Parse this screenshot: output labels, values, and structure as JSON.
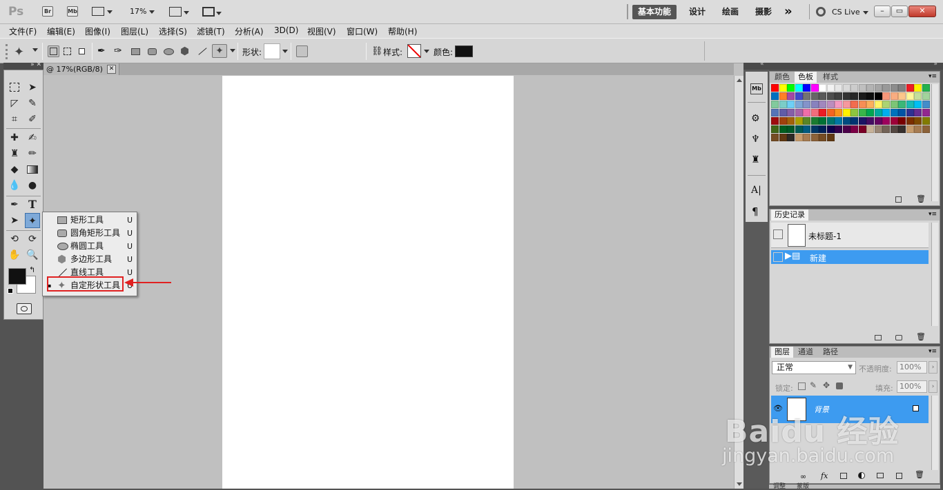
{
  "appbar": {
    "logo": "Ps",
    "app_icons": [
      "Br",
      "Mb"
    ],
    "zoom": "17%",
    "workspaces": [
      "基本功能",
      "设计",
      "绘画",
      "摄影"
    ],
    "more": "»",
    "cslive": "CS Live",
    "window_buttons": [
      "–",
      "▭",
      "✕"
    ]
  },
  "menu": [
    "文件(F)",
    "编辑(E)",
    "图像(I)",
    "图层(L)",
    "选择(S)",
    "滤镜(T)",
    "分析(A)",
    "3D(D)",
    "视图(V)",
    "窗口(W)",
    "帮助(H)"
  ],
  "options": {
    "shape_label": "形状:",
    "style_label": "样式:",
    "color_label": "颜色:",
    "color_value": "#111111"
  },
  "document": {
    "tab_title": "@ 17%(RGB/8)",
    "close": "✕"
  },
  "flyout": {
    "items": [
      {
        "label": "矩形工具",
        "key": "U"
      },
      {
        "label": "圆角矩形工具",
        "key": "U"
      },
      {
        "label": "椭圆工具",
        "key": "U"
      },
      {
        "label": "多边形工具",
        "key": "U"
      },
      {
        "label": "直线工具",
        "key": "U"
      },
      {
        "label": "自定形状工具",
        "key": "U"
      }
    ],
    "highlight_color": "#e02020"
  },
  "panels": {
    "swatches": {
      "tabs": [
        "颜色",
        "色板",
        "样式"
      ]
    },
    "history": {
      "tab": "历史记录",
      "snapshot": "未标题-1",
      "state": "新建"
    },
    "layers": {
      "tabs": [
        "图层",
        "通道",
        "路径"
      ],
      "blend_mode": "正常",
      "opacity_label": "不透明度:",
      "opacity": "100%",
      "lock_label": "锁定:",
      "fill_label": "填充:",
      "fill": "100%",
      "layer_name": "背景"
    },
    "bottom_tabs": [
      "调整",
      "蒙版"
    ]
  },
  "watermark": {
    "logo": "Baidu 经验",
    "url": "jingyan.baidu.com"
  },
  "colors": {
    "selection": "#3d9bf0",
    "foreground": "#111111",
    "background": "#ffffff"
  }
}
